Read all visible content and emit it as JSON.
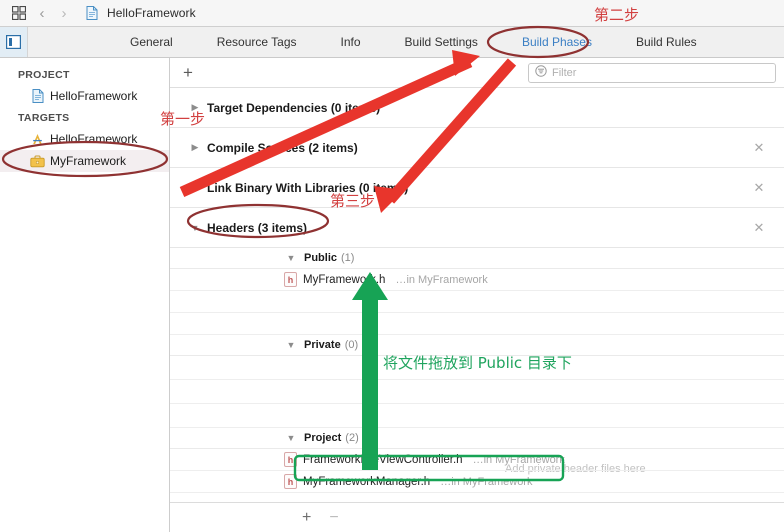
{
  "window": {
    "breadcrumb": "HelloFramework",
    "icons": {
      "panel_grid": "grid-panel-icon",
      "back": "‹",
      "forward": "›",
      "doc": "document-icon",
      "toggle": "navigator-toggle-icon"
    }
  },
  "tabs": [
    {
      "label": "General",
      "active": false
    },
    {
      "label": "Resource Tags",
      "active": false
    },
    {
      "label": "Info",
      "active": false
    },
    {
      "label": "Build Settings",
      "active": false
    },
    {
      "label": "Build Phases",
      "active": true
    },
    {
      "label": "Build Rules",
      "active": false
    }
  ],
  "sidebar": {
    "groups": [
      {
        "label": "PROJECT",
        "items": [
          {
            "label": "HelloFramework",
            "icon": "project-document-icon",
            "selected": false
          }
        ]
      },
      {
        "label": "TARGETS",
        "items": [
          {
            "label": "HelloFramework",
            "icon": "app-target-icon",
            "selected": false
          },
          {
            "label": "MyFramework",
            "icon": "framework-target-icon",
            "selected": true
          }
        ]
      }
    ]
  },
  "toolbar": {
    "add_label": "+",
    "filter_placeholder": "Filter",
    "filter_value": "",
    "filter_icon": "filter-icon"
  },
  "phases": [
    {
      "title": "Target Dependencies (0 items)",
      "expanded": false,
      "closable": false
    },
    {
      "title": "Compile Sources (2 items)",
      "expanded": false,
      "closable": true
    },
    {
      "title": "Link Binary With Libraries (0 items)",
      "expanded": false,
      "closable": true
    },
    {
      "title": "Headers (3 items)",
      "expanded": true,
      "closable": true
    }
  ],
  "headers_sections": [
    {
      "name": "Public",
      "count": "(1)",
      "files": [
        {
          "name": "MyFramework.h",
          "location": "…in MyFramework",
          "selected": false
        }
      ],
      "empty_rows": 2,
      "placeholder": ""
    },
    {
      "name": "Private",
      "count": "(0)",
      "files": [],
      "empty_rows": 3,
      "placeholder": "Add private header files here"
    },
    {
      "name": "Project",
      "count": "(2)",
      "files": [
        {
          "name": "FrameworkFileViewController.h",
          "location": "…in MyFramework",
          "selected": false
        },
        {
          "name": "MyFrameworkManager.h",
          "location": "…in MyFramework",
          "selected": true
        }
      ],
      "empty_rows": 0,
      "placeholder": ""
    }
  ],
  "bottom_bar": {
    "add_label": "+",
    "remove_label": "−"
  },
  "annotations": {
    "step1": "第一步",
    "step2": "第二步",
    "step3": "第三步",
    "drag_hint": "将文件拖放到 Public 目录下",
    "colors": {
      "red": "#e8352c",
      "red_text": "#d24040",
      "dark_red_ellipse": "#8f3232",
      "green": "#17a355",
      "green_text": "#1fa45e"
    }
  }
}
